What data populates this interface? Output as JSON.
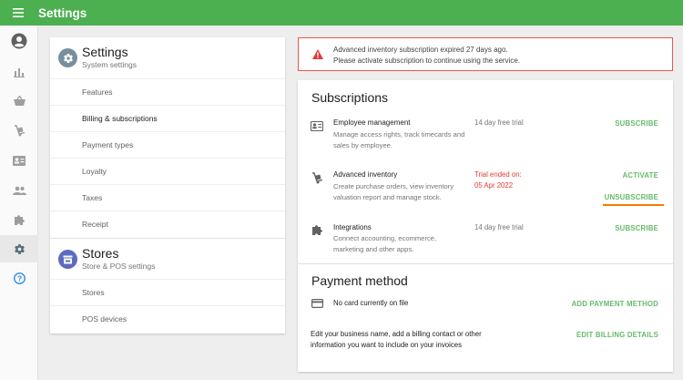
{
  "topbar": {
    "title": "Settings",
    "menu_icon": "hamburger-icon"
  },
  "rail": {
    "items": [
      {
        "icon": "account-icon"
      },
      {
        "icon": "bar-chart-icon"
      },
      {
        "icon": "basket-icon"
      },
      {
        "icon": "hand-truck-icon"
      },
      {
        "icon": "id-card-icon"
      },
      {
        "icon": "people-icon"
      },
      {
        "icon": "puzzle-icon"
      },
      {
        "icon": "gear-icon",
        "active": true
      },
      {
        "icon": "help-icon"
      }
    ]
  },
  "settings_section": {
    "title": "Settings",
    "subtitle": "System settings",
    "items": [
      {
        "label": "Features"
      },
      {
        "label": "Billing & subscriptions",
        "selected": true
      },
      {
        "label": "Payment types"
      },
      {
        "label": "Loyalty"
      },
      {
        "label": "Taxes"
      },
      {
        "label": "Receipt"
      }
    ]
  },
  "stores_section": {
    "title": "Stores",
    "subtitle": "Store & POS settings",
    "items": [
      {
        "label": "Stores"
      },
      {
        "label": "POS devices"
      }
    ]
  },
  "alert": {
    "line1": "Advanced inventory subscription expired 27 days ago.",
    "line2": "Please activate subscription to continue using the service."
  },
  "subscriptions": {
    "heading": "Subscriptions",
    "rows": [
      {
        "icon": "id-card-icon",
        "name": "Employee management",
        "desc": "Manage access rights, track timecards and sales by employee.",
        "status": "14 day free trial",
        "action": "SUBSCRIBE"
      },
      {
        "icon": "hand-truck-icon",
        "name": "Advanced inventory",
        "desc": "Create purchase orders, view inventory valuation report and manage stock.",
        "status_line1": "Trial ended on:",
        "status_line2": "05 Apr 2022",
        "action": "ACTIVATE",
        "action2": "UNSUBSCRIBE"
      },
      {
        "icon": "puzzle-icon",
        "name": "Integrations",
        "desc": "Connect accounting, ecommerce, marketing and other apps.",
        "status": "14 day free trial",
        "action": "SUBSCRIBE"
      }
    ]
  },
  "payment": {
    "heading": "Payment method",
    "card_text": "No card currently on file",
    "add_action": "ADD PAYMENT METHOD",
    "billing_text": "Edit your business name, add a billing contact or other information you want to include on your invoices",
    "billing_action": "EDIT BILLING DETAILS"
  },
  "colors": {
    "brand_green": "#4caf50",
    "action_green": "#66bb6a",
    "alert_red": "#ef5350",
    "highlight_orange": "#f57c00",
    "stores_icon_blue": "#5c6bc0"
  }
}
